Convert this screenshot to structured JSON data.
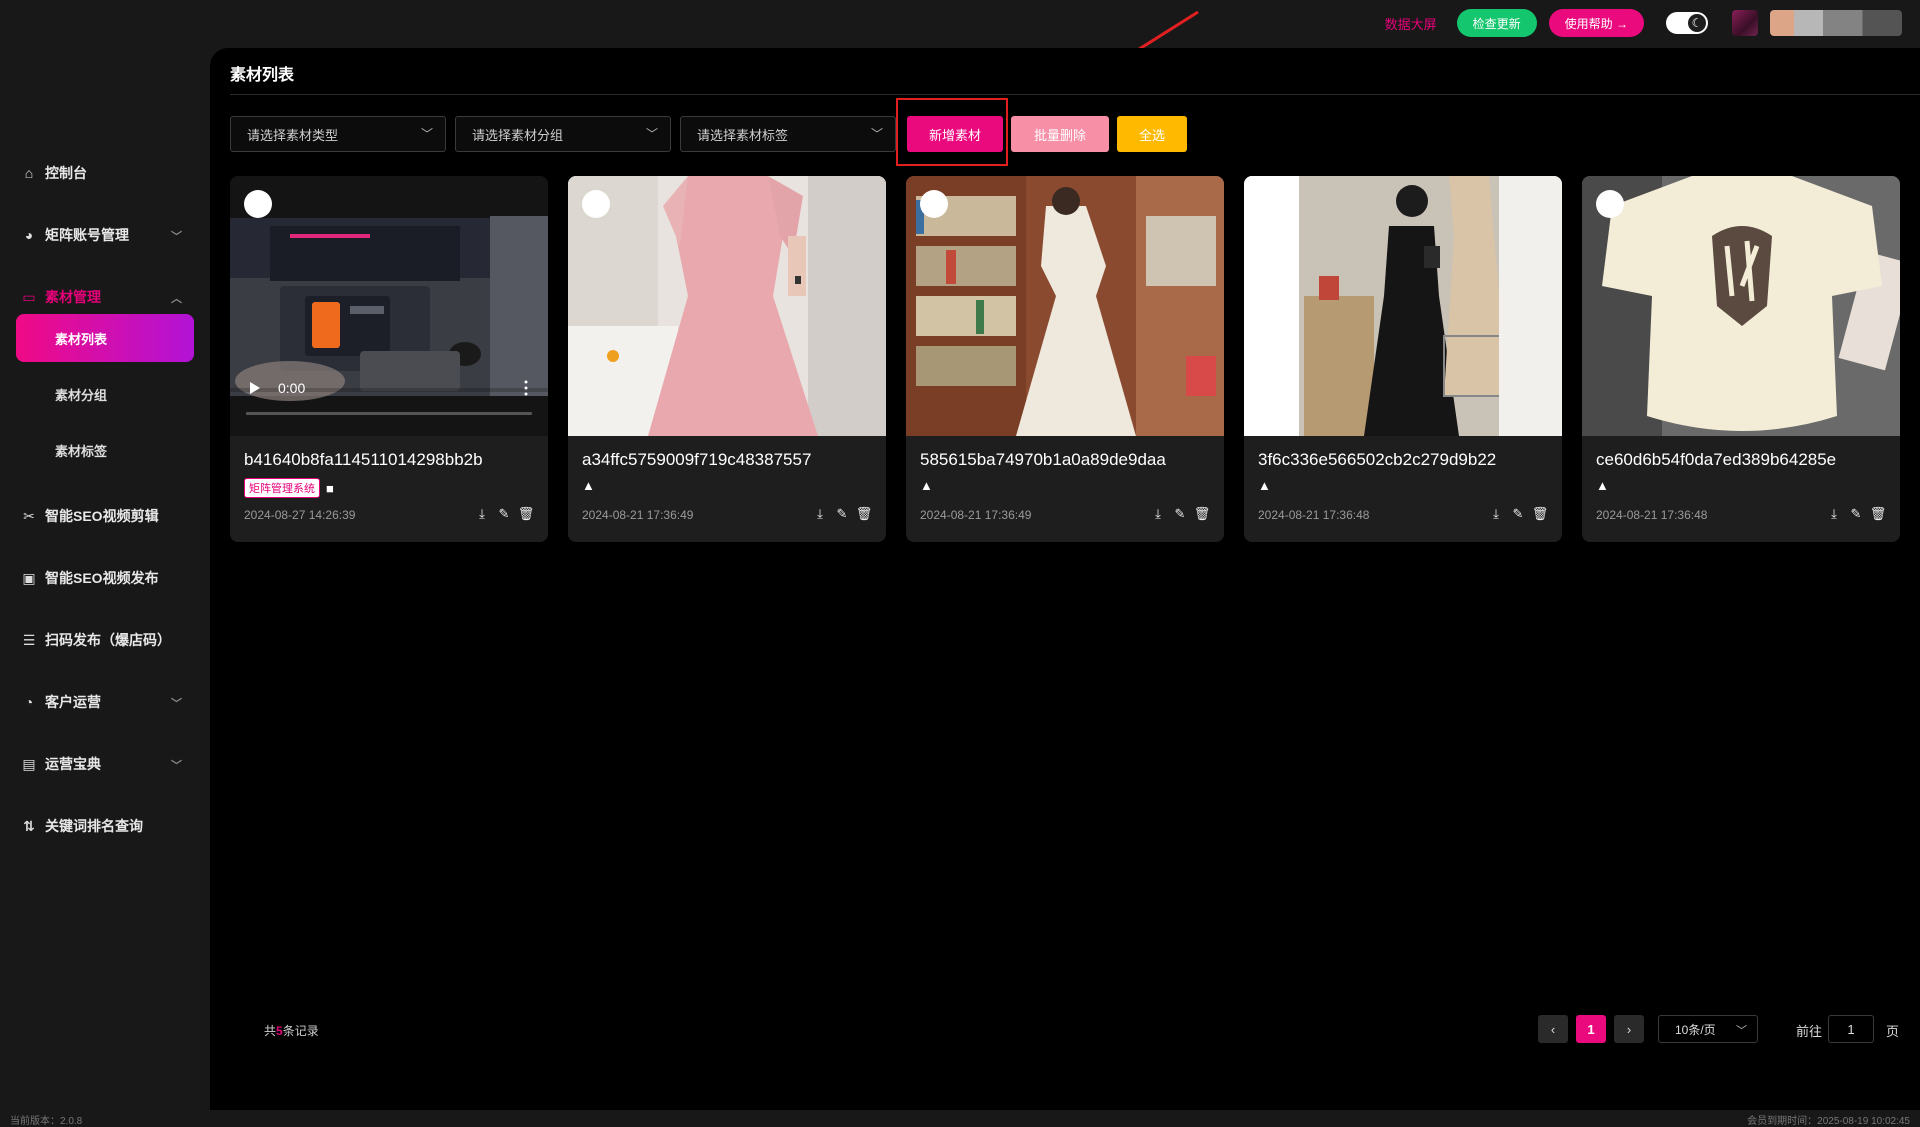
{
  "topbar": {
    "data_screen": "数据大屏",
    "check_update": "检查更新",
    "help": "使用帮助 →"
  },
  "sidebar": {
    "items": [
      {
        "label": "控制台",
        "icon": "home-icon"
      },
      {
        "label": "矩阵账号管理",
        "icon": "palette-icon"
      },
      {
        "label": "素材管理",
        "icon": "folder-icon"
      },
      {
        "label": "智能SEO视频剪辑",
        "icon": "scissors-icon"
      },
      {
        "label": "智能SEO视频发布",
        "icon": "video-icon"
      },
      {
        "label": "扫码发布（爆店码）",
        "icon": "grid-icon"
      },
      {
        "label": "客户运营",
        "icon": "pie-icon"
      },
      {
        "label": "运营宝典",
        "icon": "book-icon"
      },
      {
        "label": "关键词排名查询",
        "icon": "ranking-icon"
      }
    ],
    "sub_items": [
      {
        "label": "素材列表"
      },
      {
        "label": "素材分组"
      },
      {
        "label": "素材标签"
      }
    ]
  },
  "main": {
    "title": "素材列表",
    "filters": {
      "type_placeholder": "请选择素材类型",
      "group_placeholder": "请选择素材分组",
      "tag_placeholder": "请选择素材标签"
    },
    "buttons": {
      "add": "新增素材",
      "batch_delete": "批量删除",
      "select_all": "全选"
    },
    "video_time": "0:00",
    "cards": [
      {
        "name": "b41640b8fa114511014298bb2b",
        "date": "2024-08-27 14:26:39",
        "tag": "矩阵管理系统",
        "media": "video"
      },
      {
        "name": "a34ffc5759009f719c48387557",
        "date": "2024-08-21 17:36:49",
        "media": "image"
      },
      {
        "name": "585615ba74970b1a0a89de9daa",
        "date": "2024-08-21 17:36:49",
        "media": "image"
      },
      {
        "name": "3f6c336e566502cb2c279d9b22",
        "date": "2024-08-21 17:36:48",
        "media": "image"
      },
      {
        "name": "ce60d6b54f0da7ed389b64285e",
        "date": "2024-08-21 17:36:48",
        "media": "image"
      }
    ]
  },
  "pagination": {
    "total_prefix": "共",
    "total_count": "5",
    "total_suffix": "条记录",
    "current_page": "1",
    "page_size": "10条/页",
    "goto_label": "前往",
    "goto_value": "1",
    "page_suffix": "页"
  },
  "footer": {
    "version": "当前版本：2.0.8",
    "expire": "会员到期时间：2025-08-19 10:02:45"
  },
  "colors": {
    "accent": "#ea0a7e",
    "success": "#14c66e",
    "warning": "#ffba00",
    "danger_light": "#f78fa7"
  }
}
